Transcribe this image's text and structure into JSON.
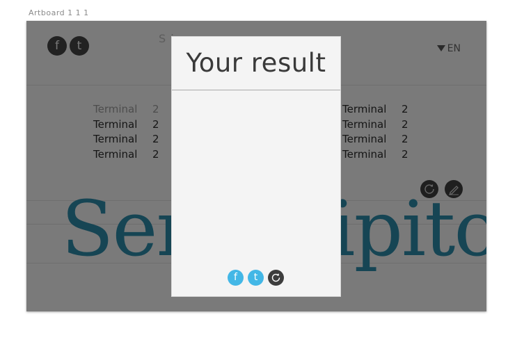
{
  "artboard": {
    "label": "Artboard 1 1 1"
  },
  "header": {
    "facebook_glyph": "f",
    "twitter_glyph": "t",
    "title": "S                                    is",
    "language": "EN"
  },
  "terminal_list": {
    "left": [
      {
        "name": "Terminal",
        "count": "2"
      },
      {
        "name": "Terminal",
        "count": "2"
      },
      {
        "name": "Terminal",
        "count": "2"
      },
      {
        "name": "Terminal",
        "count": "2"
      }
    ],
    "right": [
      {
        "name": "Terminal",
        "count": "2"
      },
      {
        "name": "Terminal",
        "count": "2"
      },
      {
        "name": "Terminal",
        "count": "2"
      },
      {
        "name": "Terminal",
        "count": "2"
      }
    ]
  },
  "background_word": "Serendipitony",
  "modal": {
    "title": "Your result",
    "facebook_glyph": "f",
    "twitter_glyph": "t",
    "refresh_icon": "refresh-icon"
  },
  "colors": {
    "accent_blue": "#43b7e6",
    "big_word": "#2d8aa8",
    "dark_button": "#3e3e3e"
  }
}
